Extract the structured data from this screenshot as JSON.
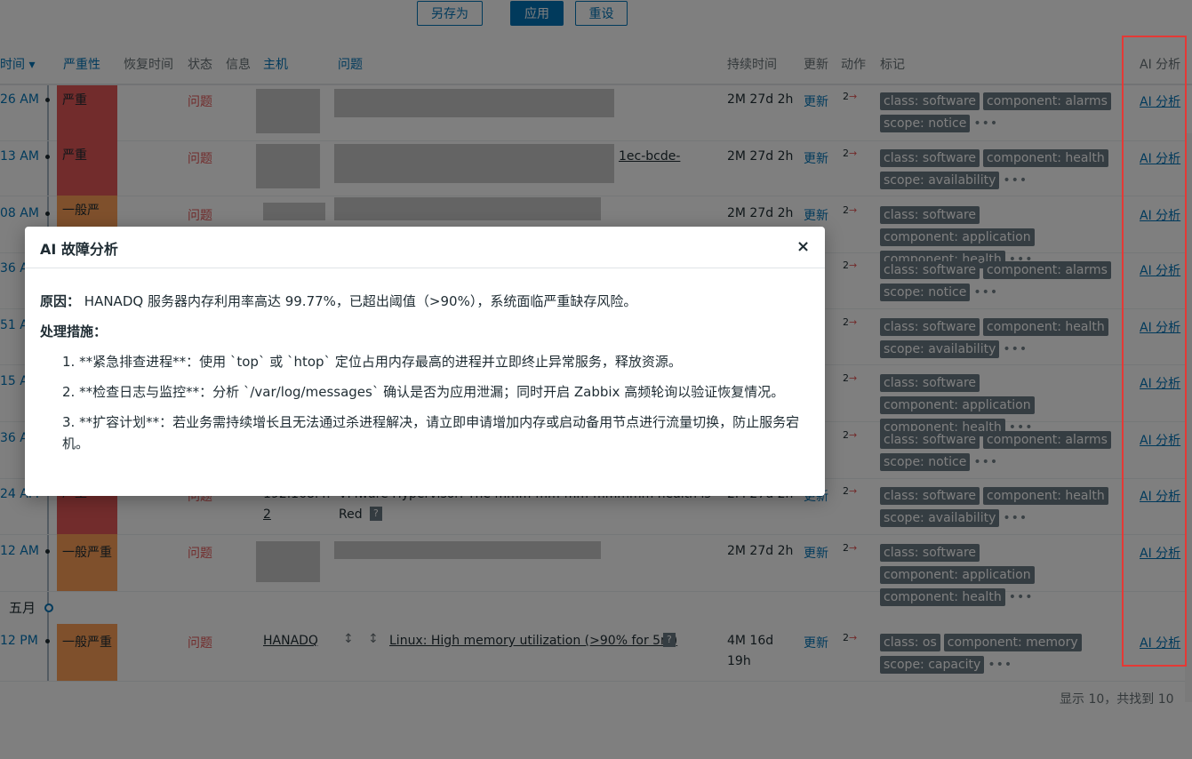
{
  "toolbar": {
    "save_as": "另存为",
    "apply": "应用",
    "reset": "重设"
  },
  "headers": {
    "time": "时间 ▾",
    "severity": "严重性",
    "recovery": "恢复时间",
    "status": "状态",
    "info": "信息",
    "host": "主机",
    "problem": "问题",
    "duration": "持续时间",
    "update": "更新",
    "actions": "动作",
    "tags": "标记",
    "ai": "AI 分析"
  },
  "rows": [
    {
      "time": "26 AM",
      "severity": "严重",
      "status": "问题",
      "duration": "2M 27d 2h",
      "update": "更新",
      "actions": "2",
      "tags": [
        "class: software",
        "component: alarms",
        "scope: notice"
      ],
      "ai": "AI 分析"
    },
    {
      "time": "13 AM",
      "severity": "严重",
      "status": "问题",
      "problem_fragment": "1ec-bcde-",
      "duration": "2M 27d 2h",
      "update": "更新",
      "actions": "2",
      "tags": [
        "class: software",
        "component: health",
        "scope: availability"
      ],
      "ai": "AI 分析"
    },
    {
      "time": "08 AM",
      "severity": "一般严",
      "status": "问题",
      "duration": "2M 27d 2h",
      "update": "更新",
      "actions": "2",
      "tags": [
        "class: software",
        "component: application",
        "component: health"
      ],
      "ai": "AI 分析"
    },
    {
      "time": "36 A",
      "tags": [
        "class: software",
        "component: alarms",
        "scope: notice"
      ],
      "actions": "2",
      "ai": "AI 分析"
    },
    {
      "time": "51 A",
      "tags": [
        "class: software",
        "component: health",
        "scope: availability"
      ],
      "actions": "2",
      "ai": "AI 分析"
    },
    {
      "time": "15 A",
      "tags": [
        "class: software",
        "component: application",
        "component: health"
      ],
      "actions": "2",
      "ai": "AI 分析"
    },
    {
      "time": "36 A",
      "tags": [
        "class: software",
        "component: alarms",
        "scope: notice"
      ],
      "actions": "2",
      "ai": "AI 分析"
    },
    {
      "time": "24 AM",
      "severity": "严重",
      "status": "问题",
      "host_line1": "192.168.4.",
      "host_line2": "2",
      "problem_line1": "VMware Hypervisor: The mmm-mm-mm-mmmmm health is",
      "problem_line2": "Red",
      "duration": "2M 27d 2h",
      "update": "更新",
      "actions": "2",
      "tags": [
        "class: software",
        "component: health",
        "scope: availability"
      ],
      "ai": "AI 分析"
    },
    {
      "time": "12 AM",
      "severity": "一般严重",
      "status": "问题",
      "duration": "2M 27d 2h",
      "update": "更新",
      "actions": "2",
      "tags": [
        "class: software",
        "component: application",
        "component: health"
      ],
      "ai": "AI 分析"
    }
  ],
  "month_label": "五月",
  "last_row": {
    "time": "12 PM",
    "severity": "一般严重",
    "status": "问题",
    "host": "HANADQ",
    "problem": "Linux: High memory utilization (>90% for 5m)",
    "duration_line1": "4M 16d",
    "duration_line2": "19h",
    "update": "更新",
    "actions": "2",
    "tags": [
      "class: os",
      "component: memory",
      "scope: capacity"
    ],
    "ai": "AI 分析"
  },
  "footer": "显示 10，共找到 10",
  "modal": {
    "title": "AI 故障分析",
    "close": "×",
    "cause_label": "原因：",
    "cause_text": "HANADQ 服务器内存利用率高达 99.77%，已超出阈值（>90%），系统面临严重缺存风险。",
    "measures_label": "处理措施：",
    "steps": [
      "1. **紧急排查进程**：使用 `top` 或 `htop` 定位占用内存最高的进程并立即终止异常服务，释放资源。",
      "2. **检查日志与监控**：分析 `/var/log/messages` 确认是否为应用泄漏；同时开启 Zabbix 高频轮询以验证恢复情况。",
      "3. **扩容计划**：若业务需持续增长且无法通过杀进程解决，请立即申请增加内存或启动备用节点进行流量切换，防止服务宕机。"
    ]
  },
  "colors": {
    "accent": "#0275b8",
    "high": "#e45959",
    "average": "#ffa059",
    "tag": "#6b7a84",
    "highlight": "#e53935"
  }
}
